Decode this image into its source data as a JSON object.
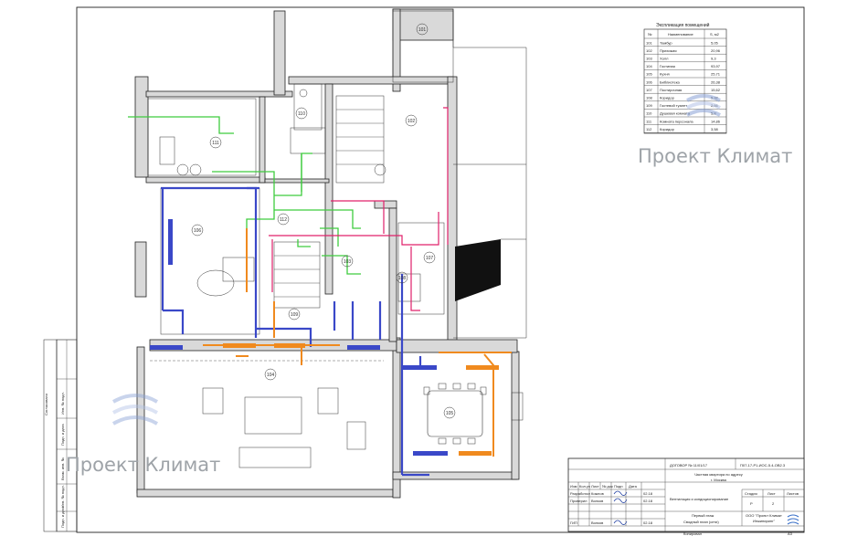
{
  "watermark": {
    "brand": "Проект Климат"
  },
  "explication": {
    "title": "Экспликация помещений",
    "headers": [
      "№",
      "Наименование",
      "S, м2"
    ],
    "rows": [
      [
        "101",
        "Тамбур",
        "5,05"
      ],
      [
        "102",
        "Прихожая",
        "20,96"
      ],
      [
        "103",
        "Холл",
        "9,3"
      ],
      [
        "104",
        "Гостиная",
        "93,97"
      ],
      [
        "105",
        "Кухня",
        "25,71"
      ],
      [
        "106",
        "Библиотека",
        "26,38"
      ],
      [
        "107",
        "Постирочная",
        "15,62"
      ],
      [
        "108",
        "Коридор",
        "5,32"
      ],
      [
        "109",
        "Гостевой туалет",
        "2,66"
      ],
      [
        "110",
        "Душевая комната",
        "5,8"
      ],
      [
        "111",
        "Комната персонала",
        "14,86"
      ],
      [
        "112",
        "Коридор",
        "3,58"
      ]
    ]
  },
  "rooms": [
    "101",
    "102",
    "103",
    "104",
    "105",
    "106",
    "107",
    "108",
    "109",
    "110",
    "111",
    "112"
  ],
  "title_block": {
    "contract": "ДОГОВОР № 11/01/17",
    "code": "П07-17-Р1-ИОС-5.4-ОВ2.3",
    "object_line1": "Частная квартира по адресу",
    "object_line2": "г. Москва",
    "section": "Вентиляция и кондиционирование",
    "sheet_title_line1": "Первый этаж",
    "sheet_title_line2": "Сводный план (сети)",
    "stage_header": "Стадия",
    "sheet_header": "Лист",
    "sheets_header": "Листов",
    "stage": "Р",
    "sheet": "2",
    "sheets": "",
    "rev_headers": [
      "Изм",
      "Кол.уч",
      "Лист",
      "№ док",
      "Подп",
      "Дата"
    ],
    "staff": [
      {
        "role": "Разработал",
        "name": "Кожнов",
        "date": "02.18"
      },
      {
        "role": "Проверил",
        "name": "Волков",
        "date": "02.18"
      },
      {
        "role": "ГИП",
        "name": "Волков",
        "date": "02.18"
      }
    ],
    "company_line1": "ООО \"Проект Климат",
    "company_line2": "Инжиниринг\"",
    "copied": "Копировал",
    "format": "A3"
  },
  "side_stamp": {
    "labels": [
      "Подп. и дата",
      "Инв. № подл.",
      "Взам. инв. №",
      "Подп. и дата",
      "Инв. № подл.",
      "Согласовано"
    ]
  },
  "colors": {
    "supply": "#3a48c8",
    "exhaust": "#f08a1e",
    "refrigerant": "#3fcc3f",
    "drain": "#e0206a",
    "wall": "#d9d9d9"
  }
}
